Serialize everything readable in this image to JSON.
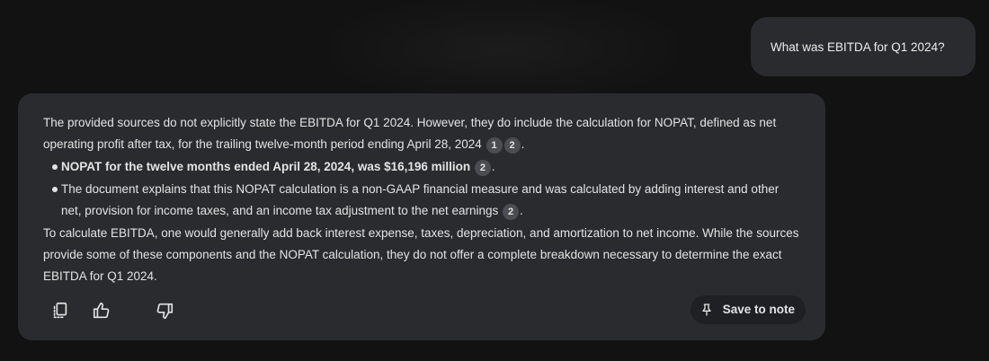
{
  "user_message": {
    "text": "What was EBITDA for Q1 2024?"
  },
  "answer": {
    "intro_part1": "The provided sources do not explicitly state the EBITDA for Q1 2024. However, they do include the calculation for NOPAT, defined as net operating profit after tax, for the trailing twelve-month period ending April 28, 2024",
    "intro_citations": [
      "1",
      "2"
    ],
    "intro_end": ".",
    "bullets": [
      {
        "text": "NOPAT for the twelve months ended April 28, 2024, was $16,196 million",
        "citation": "2",
        "end": "."
      },
      {
        "text": "The document explains that this NOPAT calculation is a non-GAAP financial measure and was calculated by adding interest and other net, provision for income taxes, and an income tax adjustment to the net earnings",
        "citation": "2",
        "end": "."
      }
    ],
    "conclusion": "To calculate EBITDA, one would generally add back interest expense, taxes, depreciation, and amortization to net income. While the sources provide some of these components and the NOPAT calculation, they do not offer a complete breakdown necessary to determine the exact EBITDA for Q1 2024."
  },
  "actions": {
    "copy_icon": "copy-icon",
    "thumbs_up_icon": "thumbs-up-icon",
    "thumbs_down_icon": "thumbs-down-icon",
    "save_icon": "pin-icon",
    "save_label": "Save to note"
  },
  "colors": {
    "background": "#121212",
    "card": "#2a2b2e",
    "text": "#e3e3e3",
    "citation_chip": "#4b4d52"
  }
}
